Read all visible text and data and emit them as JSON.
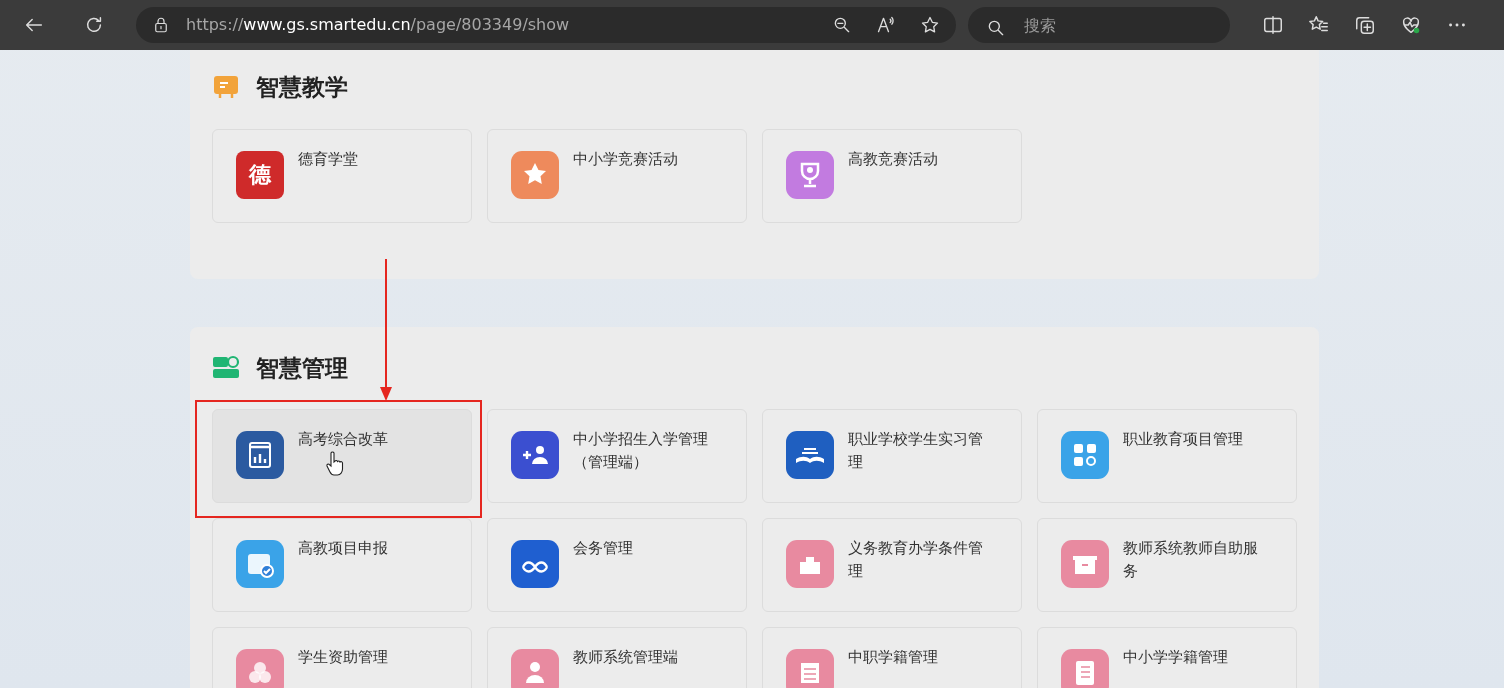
{
  "browser": {
    "url_scheme": "https://",
    "url_host": "www.gs.smartedu.cn",
    "url_path": "/page/803349/show",
    "search_placeholder": "搜索"
  },
  "sections": [
    {
      "title": "智慧教学",
      "kind": "board",
      "items": [
        {
          "label": "德育学堂",
          "kind": "glyph",
          "glyph": "德",
          "color": "#cf2a2a",
          "highlighted": false
        },
        {
          "label": "中小学竞赛活动",
          "kind": "star",
          "color": "#ee8a5c",
          "highlighted": false
        },
        {
          "label": "高教竞赛活动",
          "kind": "trophy",
          "color": "#c27be0",
          "highlighted": false
        }
      ]
    },
    {
      "title": "智慧管理",
      "kind": "monitor",
      "items": [
        {
          "label": "高考综合改革",
          "kind": "chart",
          "color": "#2b5aa0",
          "highlighted": true
        },
        {
          "label": "中小学招生入学管理（管理端）",
          "kind": "people",
          "color": "#3b4fd0",
          "highlighted": false
        },
        {
          "label": "职业学校学生实习管理",
          "kind": "book",
          "color": "#1f5fc0",
          "highlighted": false
        },
        {
          "label": "职业教育项目管理",
          "kind": "grid",
          "color": "#3aa3e8",
          "highlighted": false
        },
        {
          "label": "高教项目申报",
          "kind": "calendar",
          "color": "#3aa3e8",
          "highlighted": false
        },
        {
          "label": "会务管理",
          "kind": "link",
          "color": "#1f5fd0",
          "highlighted": false
        },
        {
          "label": "义务教育办学条件管理",
          "kind": "school",
          "color": "#e88aa0",
          "highlighted": false
        },
        {
          "label": "教师系统教师自助服务",
          "kind": "box",
          "color": "#e88aa0",
          "highlighted": false
        },
        {
          "label": "学生资助管理",
          "kind": "circles",
          "color": "#e88aa0",
          "highlighted": false
        },
        {
          "label": "教师系统管理端",
          "kind": "person",
          "color": "#e88aa0",
          "highlighted": false
        },
        {
          "label": "中职学籍管理",
          "kind": "doc",
          "color": "#e88aa0",
          "highlighted": false
        },
        {
          "label": "中小学学籍管理",
          "kind": "notebook",
          "color": "#e88aa0",
          "highlighted": false
        }
      ]
    }
  ]
}
